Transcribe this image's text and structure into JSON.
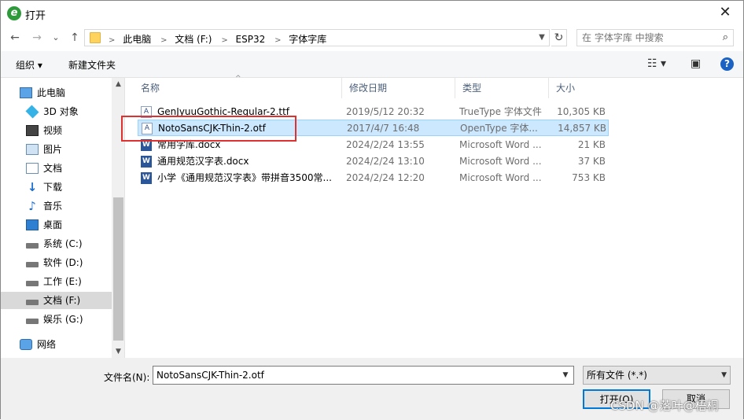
{
  "window": {
    "title": "打开",
    "close_glyph": "✕"
  },
  "nav": {
    "back": "←",
    "forward": "→",
    "history": "⌄",
    "up": "↑",
    "breadcrumbs": [
      "此电脑",
      "文档 (F:)",
      "ESP32",
      "字体字库"
    ],
    "refresh": "↻",
    "search_placeholder": "在 字体字库 中搜索"
  },
  "toolbar": {
    "organize": "组织 ▾",
    "new_folder": "新建文件夹",
    "help": "?"
  },
  "sidebar": {
    "items": [
      {
        "label": "此电脑",
        "icon": "computer-icon"
      },
      {
        "label": "3D 对象",
        "icon": "cube-icon"
      },
      {
        "label": "视频",
        "icon": "video-icon"
      },
      {
        "label": "图片",
        "icon": "picture-icon"
      },
      {
        "label": "文档",
        "icon": "document-icon"
      },
      {
        "label": "下载",
        "icon": "download-icon"
      },
      {
        "label": "音乐",
        "icon": "music-icon"
      },
      {
        "label": "桌面",
        "icon": "desktop-icon"
      },
      {
        "label": "系统 (C:)",
        "icon": "drive-icon"
      },
      {
        "label": "软件 (D:)",
        "icon": "drive-icon"
      },
      {
        "label": "工作 (E:)",
        "icon": "drive-icon"
      },
      {
        "label": "文档 (F:)",
        "icon": "drive-icon",
        "selected": true
      },
      {
        "label": "娱乐 (G:)",
        "icon": "drive-icon"
      },
      {
        "label": "网络",
        "icon": "network-icon"
      }
    ]
  },
  "list": {
    "columns": [
      "名称",
      "修改日期",
      "类型",
      "大小"
    ],
    "rows": [
      {
        "name": "GenJyuuGothic-Regular-2.ttf",
        "date": "2019/5/12 20:32",
        "type": "TrueType 字体文件",
        "size": "10,305 KB",
        "icon": "font-file-icon"
      },
      {
        "name": "NotoSansCJK-Thin-2.otf",
        "date": "2017/4/7 16:48",
        "type": "OpenType 字体...",
        "size": "14,857 KB",
        "icon": "font-file-icon",
        "selected": true
      },
      {
        "name": "常用字库.docx",
        "date": "2024/2/24 13:55",
        "type": "Microsoft Word ...",
        "size": "21 KB",
        "icon": "word-file-icon"
      },
      {
        "name": "通用规范汉字表.docx",
        "date": "2024/2/24 13:10",
        "type": "Microsoft Word ...",
        "size": "37 KB",
        "icon": "word-file-icon"
      },
      {
        "name": "小学《通用规范汉字表》带拼音3500常...",
        "date": "2024/2/24 12:20",
        "type": "Microsoft Word ...",
        "size": "753 KB",
        "icon": "word-file-icon"
      }
    ]
  },
  "bottom": {
    "filename_label": "文件名(N):",
    "filename_value": "NotoSansCJK-Thin-2.otf",
    "filetype": "所有文件 (*.*)",
    "open_button": "打开(O)",
    "cancel_button": "取消",
    "watermark": "CSDN @落叶@梧桐"
  }
}
